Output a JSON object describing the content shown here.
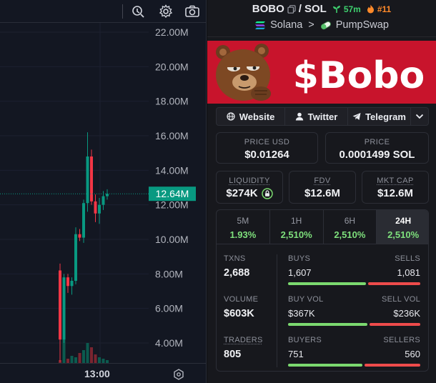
{
  "chart": {
    "price_labels": [
      "22.00M",
      "20.00M",
      "18.00M",
      "16.00M",
      "14.00M",
      "12.00M",
      "10.00M",
      "8.00M",
      "6.00M",
      "4.00M"
    ],
    "current_label": "12.64M",
    "time_label": "13:00",
    "up_color": "#089981",
    "down_color": "#f23645",
    "icons": {
      "indicator": "indicator-icon",
      "settings": "gear-icon",
      "screenshot": "camera-icon",
      "auto_scale": "auto-scale-icon"
    }
  },
  "chart_data": {
    "type": "candlestick",
    "y_unit": "M",
    "ylim": [
      2.9,
      23.1
    ],
    "candles": [
      {
        "o": 8.2,
        "h": 8.6,
        "l": 2.9,
        "c": 4.2
      },
      {
        "o": 4.2,
        "h": 8.0,
        "l": 4.0,
        "c": 7.8
      },
      {
        "o": 7.8,
        "h": 8.0,
        "l": 6.9,
        "c": 7.3
      },
      {
        "o": 7.3,
        "h": 7.8,
        "l": 6.8,
        "c": 7.6
      },
      {
        "o": 7.6,
        "h": 10.7,
        "l": 7.4,
        "c": 10.3
      },
      {
        "o": 10.3,
        "h": 10.6,
        "l": 9.9,
        "c": 10.1
      },
      {
        "o": 10.1,
        "h": 12.3,
        "l": 9.8,
        "c": 12.1
      },
      {
        "o": 12.1,
        "h": 16.2,
        "l": 11.6,
        "c": 14.8
      },
      {
        "o": 14.8,
        "h": 15.2,
        "l": 12.0,
        "c": 12.2
      },
      {
        "o": 12.2,
        "h": 12.6,
        "l": 11.0,
        "c": 11.5
      },
      {
        "o": 11.5,
        "h": 12.4,
        "l": 10.9,
        "c": 12.0
      },
      {
        "o": 12.0,
        "h": 12.8,
        "l": 11.7,
        "c": 12.5
      },
      {
        "o": 12.5,
        "h": 12.9,
        "l": 12.3,
        "c": 12.64
      }
    ],
    "volume": [
      0.1,
      1.0,
      0.15,
      0.25,
      0.2,
      0.35,
      0.45,
      0.7,
      0.55,
      0.3,
      0.2,
      0.15,
      0.1
    ]
  },
  "header": {
    "base": "BOBO",
    "separator": "/",
    "quote": "SOL",
    "age": "57m",
    "rank": "#11",
    "chain": "Solana",
    "arrow": ">",
    "dex": "PumpSwap"
  },
  "banner": {
    "text": "$Bobo",
    "bg_color": "#c8142c"
  },
  "links": {
    "website": "Website",
    "twitter": "Twitter",
    "telegram": "Telegram"
  },
  "prices": {
    "usd_label": "PRICE USD",
    "usd_value": "$0.01264",
    "native_label": "PRICE",
    "native_value": "0.0001499 SOL"
  },
  "metrics": {
    "liquidity_label": "LIQUIDITY",
    "liquidity_value": "$274K",
    "fdv_label": "FDV",
    "fdv_value": "$12.6M",
    "mcap_label": "MKT CAP",
    "mcap_value": "$12.6M"
  },
  "timeframes": [
    {
      "label": "5M",
      "value": "1.93%"
    },
    {
      "label": "1H",
      "value": "2,510%"
    },
    {
      "label": "6H",
      "value": "2,510%"
    },
    {
      "label": "24H",
      "value": "2,510%"
    }
  ],
  "stats": {
    "txns_label": "TXNS",
    "txns_value": "2,688",
    "buys_label": "BUYS",
    "buys_value": "1,607",
    "sells_label": "SELLS",
    "sells_value": "1,081",
    "buys_share": 0.598,
    "volume_label": "VOLUME",
    "volume_value": "$603K",
    "buyvol_label": "BUY VOL",
    "buyvol_value": "$367K",
    "sellvol_label": "SELL VOL",
    "sellvol_value": "$236K",
    "buyvol_share": 0.609,
    "traders_label": "TRADERS",
    "traders_value": "805",
    "buyers_label": "BUYERS",
    "buyers_value": "751",
    "sellers_label": "SELLERS",
    "sellers_value": "560",
    "buyers_share": 0.573
  }
}
